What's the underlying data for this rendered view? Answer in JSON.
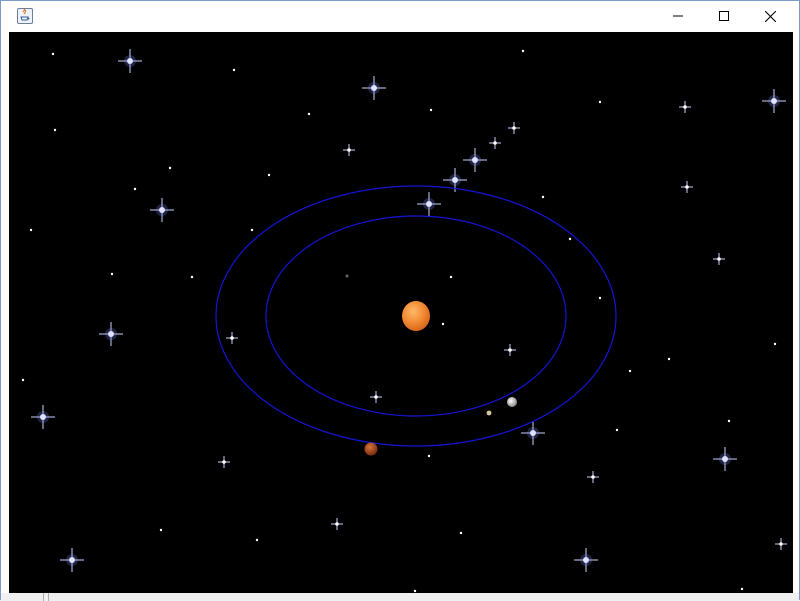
{
  "window": {
    "title": "",
    "controls": {
      "minimize_icon": "minimize-icon",
      "maximize_icon": "maximize-icon",
      "close_icon": "close-icon"
    }
  },
  "scene": {
    "background": "#000000",
    "orbit_color": "#1010d0",
    "sun_color": "#f08a30",
    "orbits": [
      "inner-orbit",
      "outer-orbit"
    ],
    "bodies": [
      {
        "name": "sun",
        "color": "#f08a30"
      },
      {
        "name": "earth",
        "color": "#cfcfcf"
      },
      {
        "name": "moon",
        "color": "#d8c8a0"
      },
      {
        "name": "mars",
        "color": "#b5501e"
      }
    ]
  }
}
